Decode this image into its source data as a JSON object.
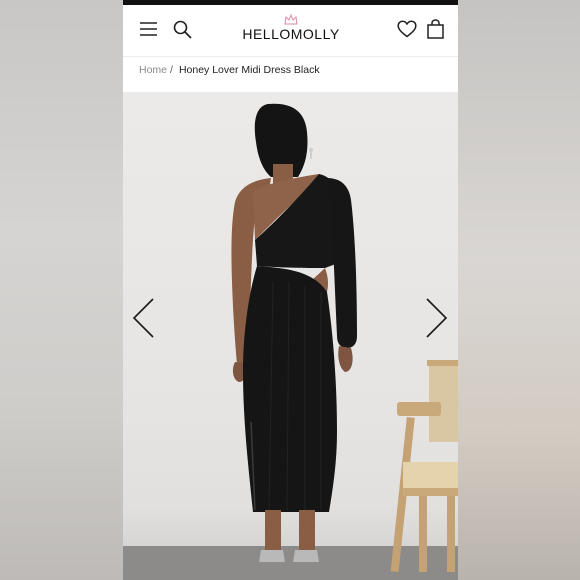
{
  "header": {
    "logo_text": "HELLOMOLLY",
    "icons": [
      "menu-icon",
      "search-icon",
      "crown-icon",
      "heart-icon",
      "bag-icon"
    ]
  },
  "breadcrumb": {
    "home": "Home",
    "separator": "/",
    "current": "Honey Lover Midi Dress Black"
  },
  "gallery": {
    "prev_icon": "chevron-left-icon",
    "next_icon": "chevron-right-icon"
  },
  "colors": {
    "brand_crown": "#d98aa0",
    "text": "#111111",
    "dress": "#161616"
  }
}
